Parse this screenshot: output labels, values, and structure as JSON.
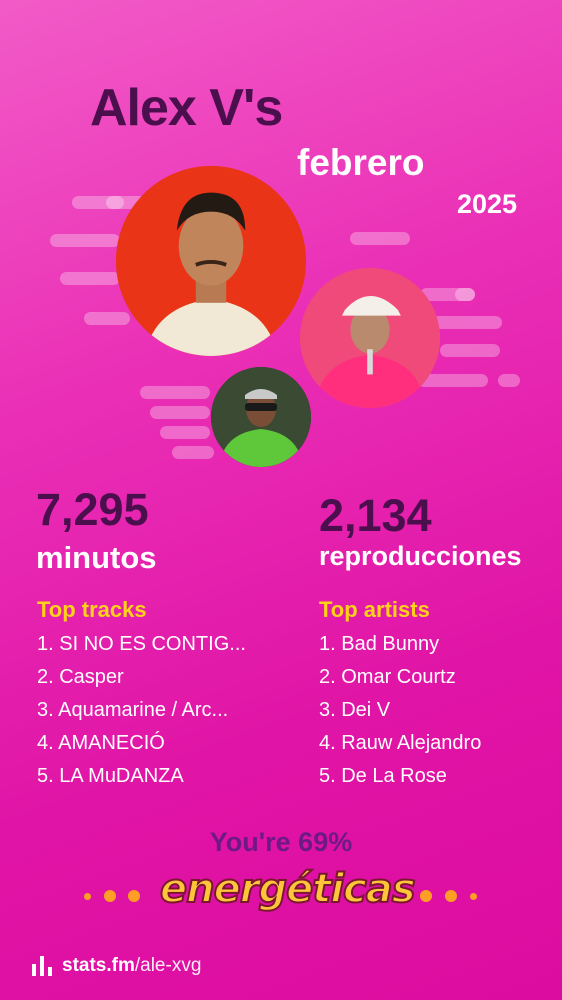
{
  "header": {
    "title": "Alex V's",
    "month": "febrero",
    "year": "2025"
  },
  "stats": {
    "minutes_value": "7,295",
    "minutes_label": "minutos",
    "plays_value": "2,134",
    "plays_label": "reproducciones"
  },
  "top_tracks": {
    "title": "Top tracks",
    "items": [
      "1. SI NO ES CONTIG...",
      "2. Casper",
      "3. Aquamarine / Arc...",
      "4. AMANECIÓ",
      "5. LA MuDANZA"
    ]
  },
  "top_artists": {
    "title": "Top artists",
    "items": [
      "1. Bad Bunny",
      "2. Omar Courtz",
      "3. Dei V",
      "4. Rauw Alejandro",
      "5. De La Rose"
    ]
  },
  "energy": {
    "line": "You're 69%",
    "word": "energéticas"
  },
  "footer": {
    "brand": "stats.fm",
    "user": "/ale-xvg",
    "icon": "bar-chart-icon"
  },
  "colors": {
    "background": "#e014a6",
    "title": "#4a0f4c",
    "accent_yellow": "#ffd21a",
    "energy_text": "#6e1a86"
  }
}
